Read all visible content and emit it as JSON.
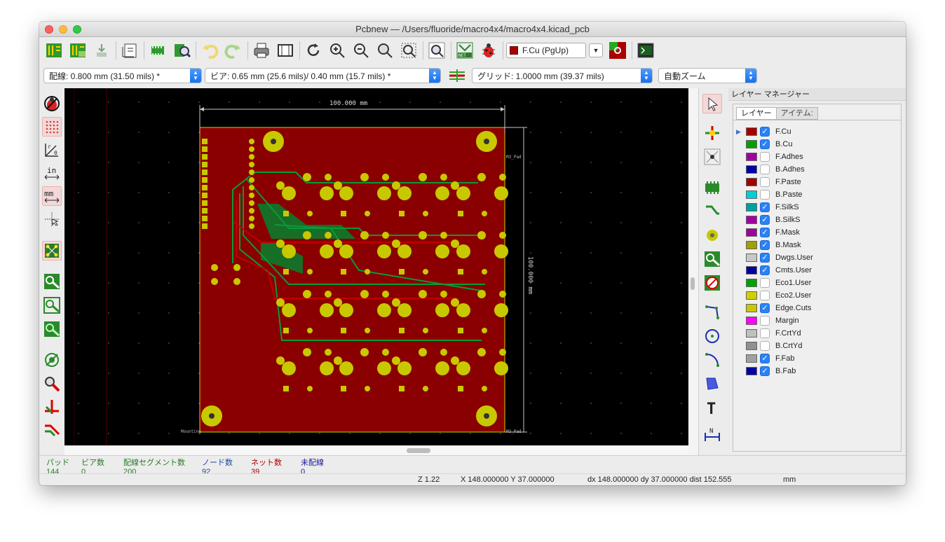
{
  "window": {
    "title": "Pcbnew — /Users/fluoride/macro4x4/macro4x4.kicad_pcb"
  },
  "toolbar": {
    "icons": [
      "new-board-icon",
      "open-board-icon",
      "save-icon",
      "page-settings-icon",
      "footprint-editor-icon",
      "footprint-viewer-icon",
      "undo-icon",
      "redo-icon",
      "print-icon",
      "plot-icon",
      "redraw-icon",
      "zoom-in-icon",
      "zoom-out-icon",
      "zoom-fit-icon",
      "zoom-selection-icon",
      "find-icon",
      "netlist-icon",
      "drc-icon",
      "layer-pair-icon",
      "scripting-console-icon"
    ],
    "active_layer": "F.Cu (PgUp)",
    "active_layer_color": "#a00000"
  },
  "options": {
    "track_width": "配線: 0.800 mm (31.50 mils) *",
    "via_size": "ビア: 0.65 mm (25.6 mils)/ 0.40 mm (15.7 mils) *",
    "grid": "グリッド: 1.0000 mm (39.37 mils)",
    "zoom": "自動ズーム"
  },
  "canvas": {
    "dim_horizontal": "100.000 mm",
    "dim_vertical": "100.000 mm",
    "label_top_right": "M3_Pad",
    "label_bottom_right": "M3_Pad",
    "label_bottom_left": "Mounting"
  },
  "layer_manager": {
    "title": "レイヤー マネージャー",
    "tabs": [
      "レイヤー",
      "アイテム:"
    ],
    "layers": [
      {
        "name": "F.Cu",
        "color": "#a50000",
        "visible": true,
        "selected": true
      },
      {
        "name": "B.Cu",
        "color": "#00a000",
        "visible": true
      },
      {
        "name": "F.Adhes",
        "color": "#a000a0",
        "visible": false
      },
      {
        "name": "B.Adhes",
        "color": "#0000a0",
        "visible": false
      },
      {
        "name": "F.Paste",
        "color": "#a00000",
        "visible": false
      },
      {
        "name": "B.Paste",
        "color": "#00d0d0",
        "visible": false
      },
      {
        "name": "F.SilkS",
        "color": "#00a0a0",
        "visible": true
      },
      {
        "name": "B.SilkS",
        "color": "#a000a0",
        "visible": true
      },
      {
        "name": "F.Mask",
        "color": "#a000a0",
        "visible": true
      },
      {
        "name": "B.Mask",
        "color": "#a0a000",
        "visible": true
      },
      {
        "name": "Dwgs.User",
        "color": "#c8c8c8",
        "visible": true
      },
      {
        "name": "Cmts.User",
        "color": "#0000a0",
        "visible": true
      },
      {
        "name": "Eco1.User",
        "color": "#00a000",
        "visible": false
      },
      {
        "name": "Eco2.User",
        "color": "#d0d000",
        "visible": false
      },
      {
        "name": "Edge.Cuts",
        "color": "#c8c800",
        "visible": true
      },
      {
        "name": "Margin",
        "color": "#ff00ff",
        "visible": false
      },
      {
        "name": "F.CrtYd",
        "color": "#c0c0c0",
        "visible": false
      },
      {
        "name": "B.CrtYd",
        "color": "#909090",
        "visible": false
      },
      {
        "name": "F.Fab",
        "color": "#a0a0a0",
        "visible": true
      },
      {
        "name": "B.Fab",
        "color": "#0000a0",
        "visible": true
      }
    ]
  },
  "status": {
    "pads_label": "パッド",
    "pads_value": "144",
    "vias_label": "ビア数",
    "vias_value": "0",
    "segments_label": "配線セグメント数",
    "segments_value": "200",
    "nodes_label": "ノード数",
    "nodes_value": "92",
    "nets_label": "ネット数",
    "nets_value": "39",
    "unrouted_label": "未配線",
    "unrouted_value": "0",
    "zoom": "Z 1.22",
    "xy": "X 148.000000  Y 37.000000",
    "delta": "dx 148.000000  dy 37.000000  dist 152.555",
    "units": "mm"
  }
}
